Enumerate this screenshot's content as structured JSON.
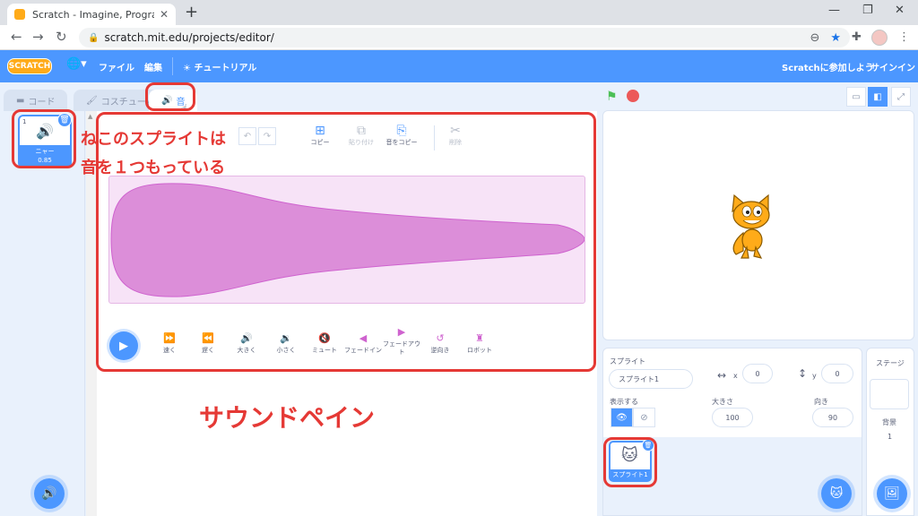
{
  "browser": {
    "tab_title": "Scratch - Imagine, Program, Shar",
    "url": "scratch.mit.edu/projects/editor/"
  },
  "menubar": {
    "logo": "SCRATCH",
    "file": "ファイル",
    "edit": "編集",
    "tutorials": "チュートリアル",
    "join": "Scratchに参加しよう",
    "signin": "サインイン"
  },
  "editor_tabs": {
    "code": "コード",
    "costumes": "コスチューム",
    "sounds": "音"
  },
  "sound_list": {
    "items": [
      {
        "index": "1",
        "name": "ニャー",
        "duration": "0.85"
      }
    ]
  },
  "toolbar": {
    "copy": "コピー",
    "paste": "貼り付け",
    "copy_to_new": "音をコピー",
    "delete": "削除"
  },
  "effects": [
    {
      "label": "速く",
      "icon": "faster-icon"
    },
    {
      "label": "遅く",
      "icon": "slower-icon"
    },
    {
      "label": "大きく",
      "icon": "louder-icon"
    },
    {
      "label": "小さく",
      "icon": "softer-icon"
    },
    {
      "label": "ミュート",
      "icon": "mute-icon"
    },
    {
      "label": "フェードイン",
      "icon": "fade-in-icon"
    },
    {
      "label": "フェードアウト",
      "icon": "fade-out-icon"
    },
    {
      "label": "逆向き",
      "icon": "reverse-icon"
    },
    {
      "label": "ロボット",
      "icon": "robot-icon"
    }
  ],
  "annotations": {
    "note_line1": "ねこのスプライトは",
    "note_line2": "音を１つもっている",
    "pane_label": "サウンドペイン",
    "color": "#e53935"
  },
  "sprite_info": {
    "sprite_label": "スプライト",
    "sprite_name": "スプライト1",
    "x_label": "x",
    "x_value": "0",
    "y_label": "y",
    "y_value": "0",
    "show_label": "表示する",
    "size_label": "大きさ",
    "size_value": "100",
    "direction_label": "向き",
    "direction_value": "90"
  },
  "sprite_list": {
    "items": [
      {
        "name": "スプライト1"
      }
    ]
  },
  "stage_pane": {
    "title": "ステージ",
    "backdrops_label": "背景",
    "backdrops_count": "1"
  },
  "colors": {
    "accent": "#4c97ff",
    "sound": "#cf63cf",
    "waveform": "#dc8ed9"
  }
}
